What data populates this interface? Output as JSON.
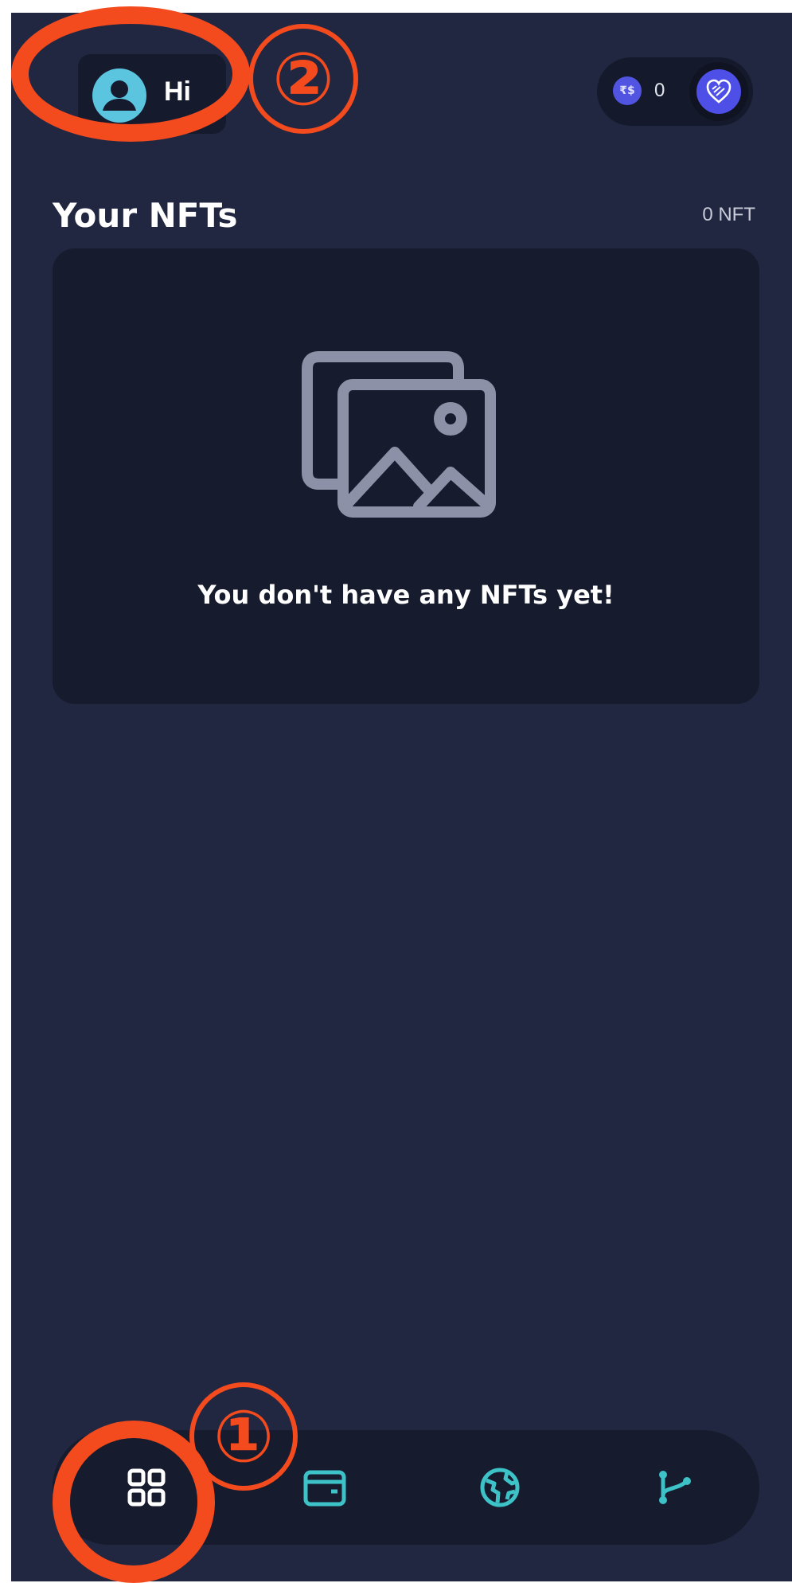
{
  "header": {
    "greeting": "Hi",
    "balance": {
      "token_icon_label": "₹$",
      "value": "0"
    },
    "profile_icon": "user-avatar-icon",
    "heart_icon": "heart-badge-icon"
  },
  "nfts": {
    "section_title": "Your NFTs",
    "count_label": "0 NFT",
    "empty_icon": "images-stack-icon",
    "empty_message": "You don't have any NFTs yet!"
  },
  "bottom_nav": {
    "items": [
      {
        "icon": "grid-icon",
        "active": true
      },
      {
        "icon": "wallet-icon",
        "active": false
      },
      {
        "icon": "globe-icon",
        "active": false
      },
      {
        "icon": "branch-icon",
        "active": false
      }
    ]
  },
  "annotations": {
    "marker_1": "①",
    "marker_2": "②"
  },
  "colors": {
    "background": "#222741",
    "card": "#161b2e",
    "accent": "#3cc2c7",
    "annotation": "#f34a1e",
    "avatar": "#5bc4df"
  }
}
